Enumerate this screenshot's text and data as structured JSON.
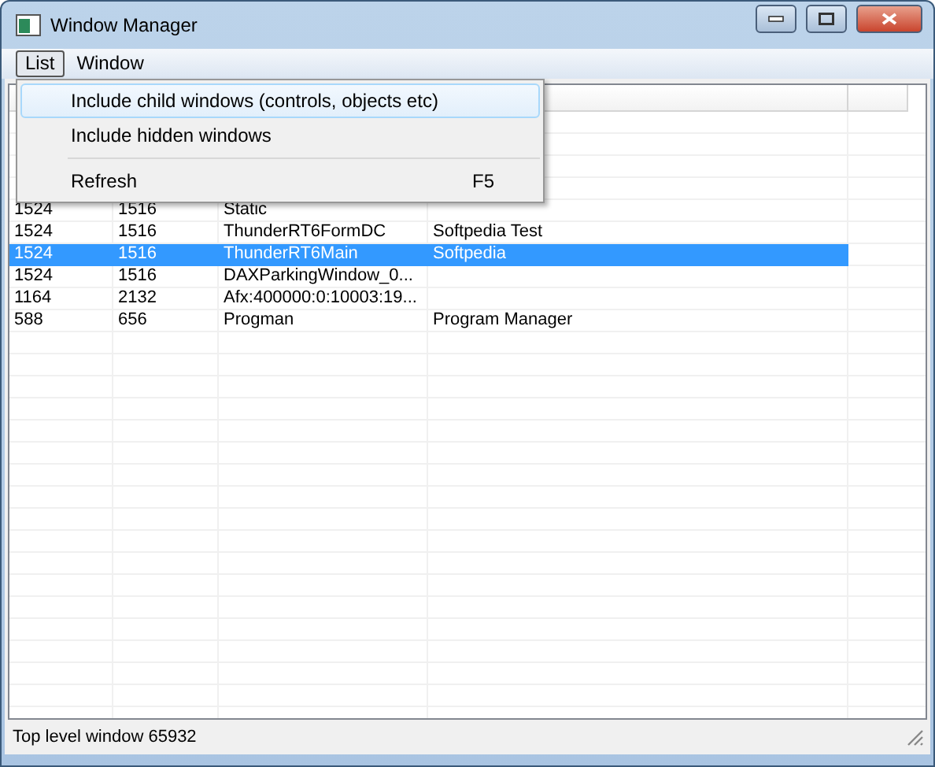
{
  "window": {
    "title": "Window Manager"
  },
  "menubar": [
    {
      "label": "List",
      "selected": true
    },
    {
      "label": "Window",
      "selected": false
    }
  ],
  "menu": [
    {
      "kind": "item",
      "label": "Include child windows (controls, objects etc)",
      "selected": true
    },
    {
      "kind": "item",
      "label": "Include hidden windows",
      "selected": false
    },
    {
      "kind": "separator"
    },
    {
      "kind": "item",
      "label": "Refresh",
      "shortcut": "F5",
      "selected": false
    }
  ],
  "table": {
    "rows": [
      {
        "cells": [
          "1524",
          "1516",
          "Static",
          ""
        ],
        "selected": false
      },
      {
        "cells": [
          "1524",
          "1516",
          "ThunderRT6FormDC",
          "Softpedia Test"
        ],
        "selected": false
      },
      {
        "cells": [
          "1524",
          "1516",
          "ThunderRT6Main",
          "Softpedia"
        ],
        "selected": true
      },
      {
        "cells": [
          "1524",
          "1516",
          "DAXParkingWindow_0...",
          ""
        ],
        "selected": false
      },
      {
        "cells": [
          "1164",
          "2132",
          "Afx:400000:0:10003:19...",
          ""
        ],
        "selected": false
      },
      {
        "cells": [
          "588",
          "656",
          "Progman",
          "Program Manager"
        ],
        "selected": false
      }
    ]
  },
  "status_bar": "Top level window 65932"
}
